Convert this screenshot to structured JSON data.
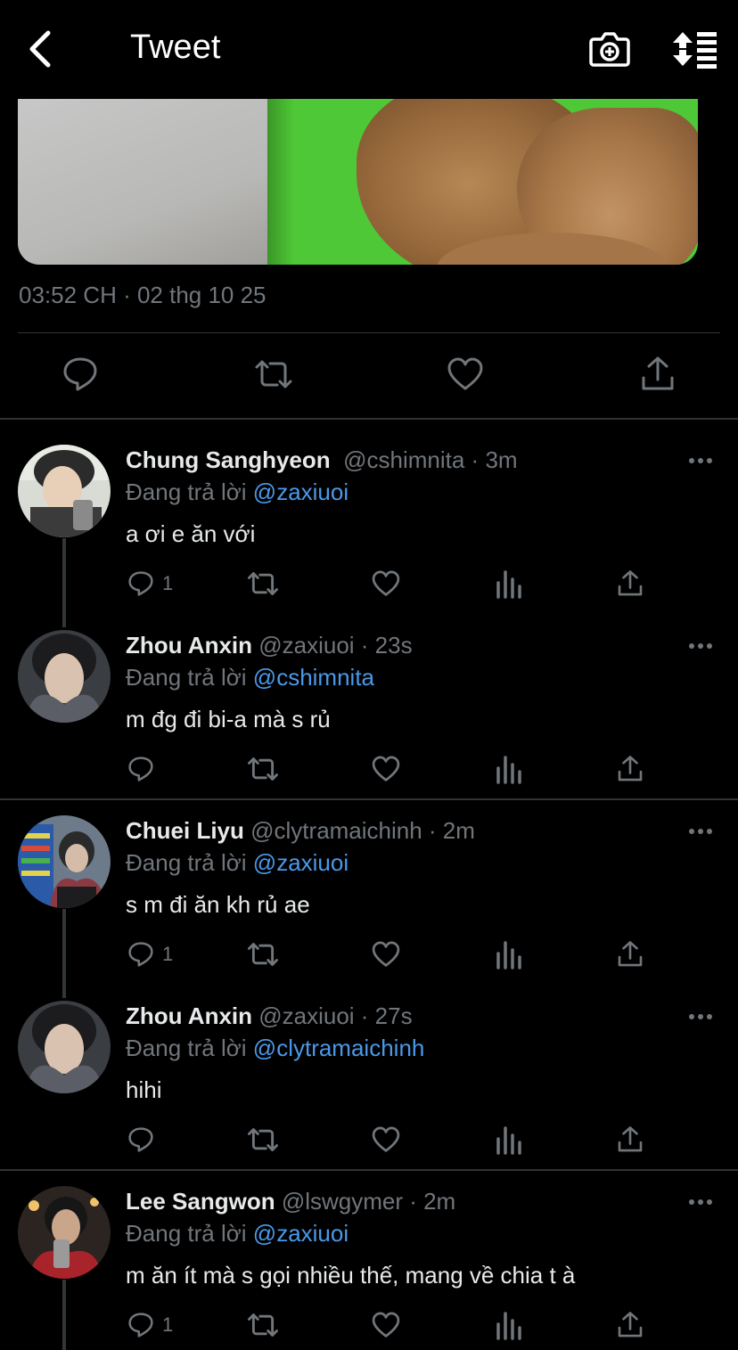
{
  "header": {
    "title": "Tweet"
  },
  "tweet": {
    "timestamp": "03:52 CH · 02 thg 10 25"
  },
  "colors": {
    "background": "#000000",
    "text": "#e7e9ea",
    "muted": "#71767b",
    "mention": "#4a99e9",
    "divider": "#2f3336"
  },
  "replies": [
    {
      "name": "Chung Sanghyeon",
      "handle": "@cshimnita · 3m",
      "replying_prefix": "Đang trả lời",
      "replying_to": "@zaxiuoi",
      "text": "a ơi e ăn với",
      "reply_count": "1"
    },
    {
      "name": "Zhou Anxin",
      "handle": "@zaxiuoi · 23s",
      "replying_prefix": "Đang trả lời",
      "replying_to": "@cshimnita",
      "text": "m đg đi bi-a mà s rủ",
      "reply_count": ""
    },
    {
      "name": "Chuei Liyu",
      "handle": "@clytramaichinh · 2m",
      "replying_prefix": "Đang trả lời",
      "replying_to": "@zaxiuoi",
      "text": "s m đi ăn kh rủ ae",
      "reply_count": "1"
    },
    {
      "name": "Zhou Anxin",
      "handle": "@zaxiuoi · 27s",
      "replying_prefix": "Đang trả lời",
      "replying_to": "@clytramaichinh",
      "text": "hihi",
      "reply_count": ""
    },
    {
      "name": "Lee Sangwon",
      "handle": "@lswgymer · 2m",
      "replying_prefix": "Đang trả lời",
      "replying_to": "@zaxiuoi",
      "text": "m ăn ít mà s gọi nhiều thế, mang về chia t à",
      "reply_count": "1"
    }
  ],
  "icons": {
    "back": "chevron-left-icon",
    "camera": "camera-plus-icon",
    "sort": "sort-icon",
    "reply": "reply-icon",
    "retweet": "retweet-icon",
    "like": "heart-icon",
    "views": "views-icon",
    "share": "share-icon",
    "more": "more-icon"
  }
}
